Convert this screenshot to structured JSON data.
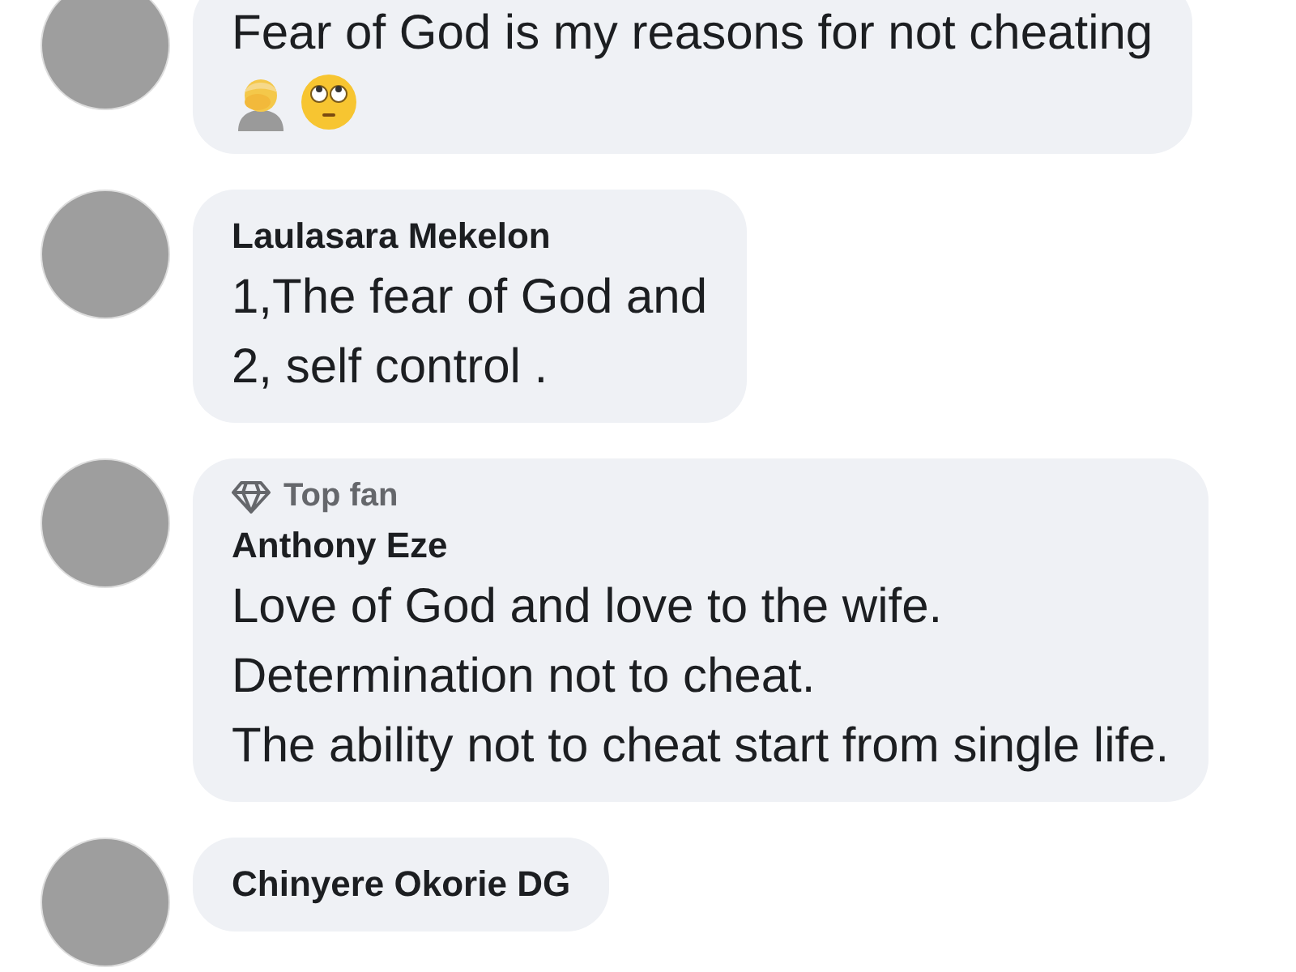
{
  "comments": [
    {
      "lines": [
        "Fear of God is my reasons for not cheating"
      ],
      "emojis": [
        {
          "kind": "facepalm"
        },
        {
          "kind": "eye-roll"
        }
      ]
    },
    {
      "author": "Laulasara Mekelon",
      "lines": [
        "1,The fear of God and",
        "2, self control ."
      ]
    },
    {
      "author": "Anthony Eze",
      "badge": "Top fan",
      "lines": [
        "Love of God and love to the wife.",
        "Determination not to cheat.",
        "The ability not to cheat start from single life."
      ]
    },
    {
      "author": "Chinyere Okorie DG"
    }
  ]
}
